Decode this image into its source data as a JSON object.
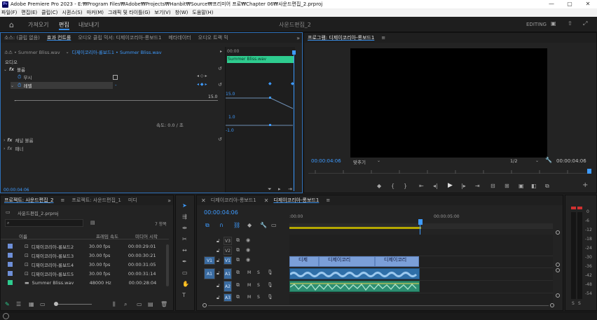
{
  "window": {
    "title": "Adobe Premiere Pro 2023 - E:₩Program Files₩Adobe₩Projects₩Hanbit₩Source₩프리미어 프로₩Chapter 06₩사운드편집_2.prproj",
    "logo": "Pr"
  },
  "menu": [
    "파일(F)",
    "편집(E)",
    "클립(C)",
    "시퀀스(S)",
    "마커(M)",
    "그래픽 및 타이틀(G)",
    "보기(V)",
    "창(W)",
    "도움말(H)"
  ],
  "header": {
    "tabs": [
      "가져오기",
      "편집",
      "내보내기"
    ],
    "active_tab": "편집",
    "project_name": "사운드편집_2",
    "workspace": "EDITING"
  },
  "effect_controls": {
    "tabs": [
      "소스: (클립 없음)",
      "효과 컨트롤",
      "오디오 클립 믹서: 디제이코리아-롱보드1",
      "메타데이터",
      "오디오 트랙 믹"
    ],
    "active_tab": "효과 컨트롤",
    "source_label": "소스 • Summer Bliss.wav",
    "clip_label": "디제이코리아-롱보드1 • Summer Bliss.wav",
    "timecode_start": "00:00",
    "clip_name": "Summer Bliss.wav",
    "section_audio": "오디오",
    "fx_volume": "볼륨",
    "bypass_label": "무시",
    "level_label": "레벨",
    "level_max": "15.0",
    "level_value": "15.0",
    "graph_top": "1.0",
    "graph_bottom": "-1.0",
    "speed_label": "속도: 0.0 / 초",
    "fx_channel_volume": "채널 볼륨",
    "fx_panner": "패너",
    "timecode": "00:00:04:06"
  },
  "program_monitor": {
    "title": "프로그램: 디제이코리아-롱보드1",
    "timecode": "00:00:04:06",
    "fit": "맞추기",
    "resolution": "1/2",
    "duration": "00:00:04:06"
  },
  "project": {
    "tabs": [
      "프로젝트: 사운드편집_2",
      "프로젝트: 사운드편집_1",
      "미디"
    ],
    "active_tab": "프로젝트: 사운드편집_2",
    "path": "사운드편집_2.prproj",
    "search_placeholder": "",
    "item_count": "7 항목",
    "columns": [
      "이름",
      "프레임 속도",
      "미디어 시작"
    ],
    "items": [
      {
        "color": "#6e8fd8",
        "name": "디제이코리아-롱보드2",
        "fps": "30.00 fps",
        "start": "00:00:29:01"
      },
      {
        "color": "#6e8fd8",
        "name": "디제이코리아-롱보드3",
        "fps": "30.00 fps",
        "start": "00:00:30:21"
      },
      {
        "color": "#6e8fd8",
        "name": "디제이코리아-롱보드4",
        "fps": "30.00 fps",
        "start": "00:00:31:05"
      },
      {
        "color": "#6e8fd8",
        "name": "디제이코리아-롱보드5",
        "fps": "30.00 fps",
        "start": "00:00:31:14"
      },
      {
        "color": "#2ecc8f",
        "name": "Summer Bliss.wav",
        "fps": "48000 Hz",
        "start": "00:00:28:04"
      }
    ]
  },
  "timeline": {
    "tabs": [
      "디제이코리아-롱보드1",
      "디제이코리아-롱보드1"
    ],
    "active_tab_index": 1,
    "timecode": "00:00:04:06",
    "ruler_start": ":00:00",
    "ruler_mark": "00:00:05:00",
    "video_tracks": [
      "V3",
      "V2",
      "V1"
    ],
    "audio_tracks": [
      "A1",
      "A2",
      "A3"
    ],
    "source_patch_video": "V1",
    "source_patch_audio": "A1",
    "clips_v1": [
      "디제",
      "디제이코리",
      "디제이코리"
    ],
    "master_db": [
      "0",
      "-6",
      "-12",
      "-18",
      "-24",
      "-30",
      "-36",
      "-42",
      "-48",
      "-54"
    ],
    "meter_bottom": [
      "S",
      "S"
    ]
  },
  "colors": {
    "accent": "#3e9bff",
    "clip_video": "#7b9fd8",
    "clip_audio": "#2d8e72",
    "graph_clip": "#2ecc8f"
  }
}
